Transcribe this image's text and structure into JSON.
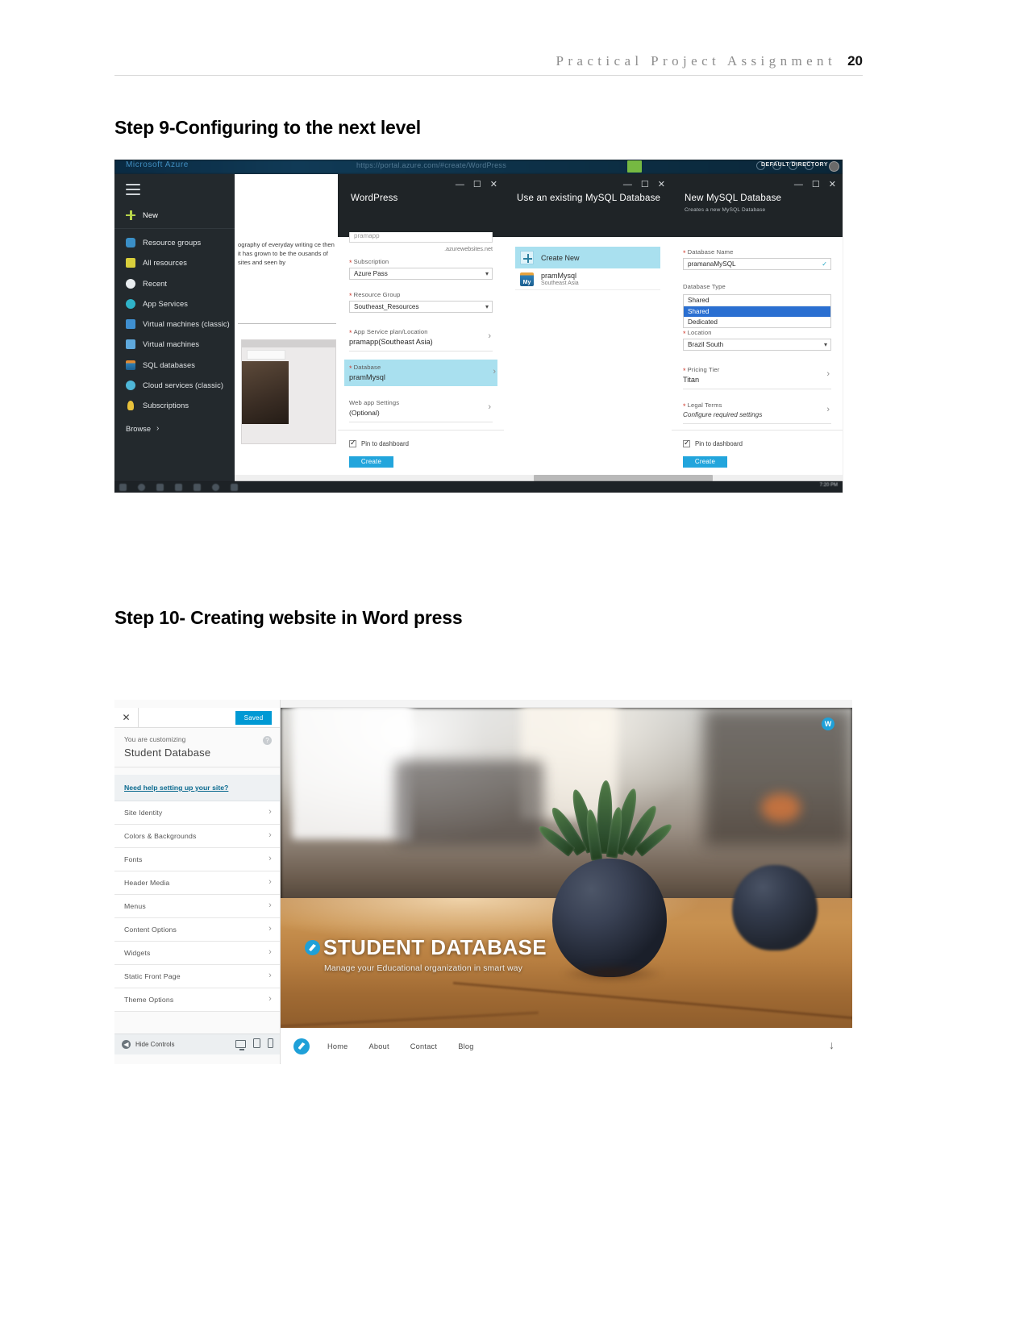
{
  "document": {
    "header_title": "Practical Project Assignment",
    "page_number": "20",
    "step9_heading": "Step 9-Configuring to the next level",
    "step10_heading": "Step 10- Creating website in Word press"
  },
  "azure": {
    "brand": "Microsoft Azure",
    "url_hint": "https://portal.azure.com/#create/WordPress",
    "directory_label": "DEFAULT DIRECTORY",
    "nav": {
      "new_label": "New",
      "items": [
        "Resource groups",
        "All resources",
        "Recent",
        "App Services",
        "Virtual machines (classic)",
        "Virtual machines",
        "SQL databases",
        "Cloud services (classic)",
        "Subscriptions"
      ],
      "browse_label": "Browse"
    },
    "background_blade": {
      "paragraph": "ography of everyday writing ce then it has grown to be the ousands of sites and seen by"
    },
    "wordpress_blade": {
      "title": "WordPress",
      "url_suffix": ".azurewebsites.net",
      "name_stub": "pramapp",
      "subscription_label": "Subscription",
      "subscription_value": "Azure Pass",
      "resource_group_label": "Resource Group",
      "resource_group_value": "Southeast_Resources",
      "app_service_label": "App Service plan/Location",
      "app_service_value": "pramapp(Southeast Asia)",
      "database_label": "Database",
      "database_value": "pramMysql",
      "webapp_label": "Web app Settings",
      "webapp_value": "(Optional)",
      "pin_label": "Pin to dashboard",
      "create_label": "Create"
    },
    "mysql_picker_blade": {
      "title": "Use an existing MySQL Database",
      "create_new_label": "Create New",
      "existing_name": "pramMysql",
      "existing_region": "Southeast Asia",
      "mysql_icon_text": "My"
    },
    "new_mysql_blade": {
      "title": "New MySQL Database",
      "subtitle": "Creates a new MySQL Database",
      "db_name_label": "Database Name",
      "db_name_value": "pramanaMySQL",
      "db_type_label": "Database Type",
      "db_type_value": "Shared",
      "db_type_options": [
        "Shared",
        "Dedicated"
      ],
      "db_type_selected": "Shared",
      "location_label": "Location",
      "location_value": "Brazil South",
      "pricing_label": "Pricing Tier",
      "pricing_value": "Titan",
      "legal_label": "Legal Terms",
      "legal_value": "Configure required settings",
      "pin_label": "Pin to dashboard",
      "create_label": "Create"
    },
    "taskbar_clock": "7:20 PM"
  },
  "wordpress": {
    "customizer": {
      "close_icon": "✕",
      "saved_label": "Saved",
      "customizing_label": "You are customizing",
      "site_name": "Student Database",
      "help_icon": "?",
      "help_link": "Need help setting up your site?",
      "menu_items": [
        "Site Identity",
        "Colors & Backgrounds",
        "Fonts",
        "Header Media",
        "Menus",
        "Content Options",
        "Widgets",
        "Static Front Page",
        "Theme Options"
      ],
      "hide_controls_label": "Hide Controls",
      "hide_controls_icon": "◀"
    },
    "preview": {
      "site_title": "STUDENT DATABASE",
      "tagline": "Manage your Educational organization in smart way",
      "wp_icon_text": "W",
      "nav_links": [
        "Home",
        "About",
        "Contact",
        "Blog"
      ],
      "scroll_arrow": "↓"
    }
  }
}
